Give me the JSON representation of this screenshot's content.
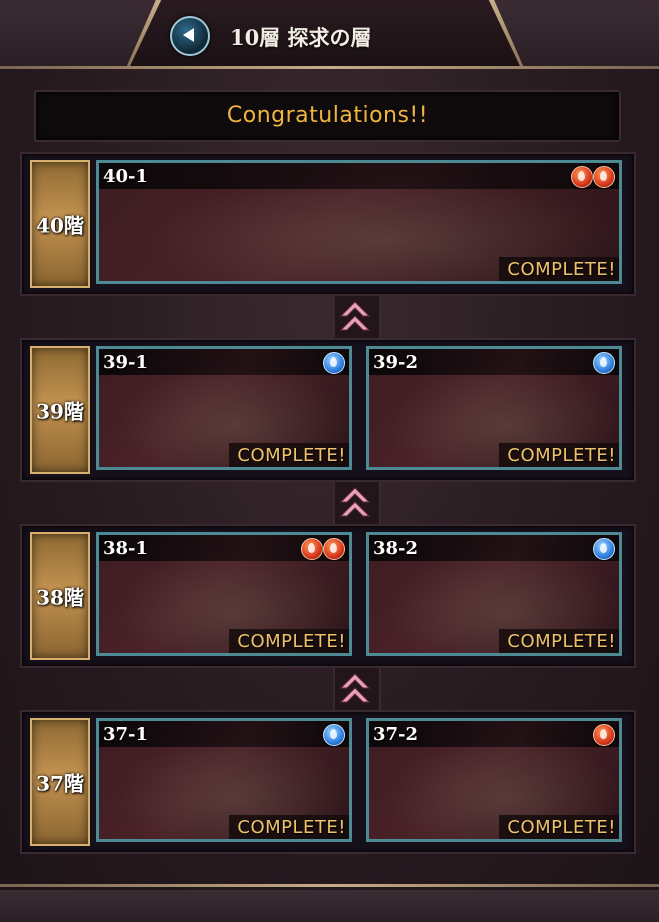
{
  "header": {
    "title": "10層 探求の層"
  },
  "congrats_text": "Congratulations!!",
  "floors": [
    {
      "label": "40階",
      "stages": [
        {
          "name": "40-1",
          "elements": [
            "fire",
            "fire"
          ],
          "status": "COMPLETE!"
        }
      ]
    },
    {
      "label": "39階",
      "stages": [
        {
          "name": "39-1",
          "elements": [
            "water"
          ],
          "status": "COMPLETE!"
        },
        {
          "name": "39-2",
          "elements": [
            "water"
          ],
          "status": "COMPLETE!"
        }
      ]
    },
    {
      "label": "38階",
      "stages": [
        {
          "name": "38-1",
          "elements": [
            "fire",
            "fire"
          ],
          "status": "COMPLETE!"
        },
        {
          "name": "38-2",
          "elements": [
            "water"
          ],
          "status": "COMPLETE!"
        }
      ]
    },
    {
      "label": "37階",
      "stages": [
        {
          "name": "37-1",
          "elements": [
            "water"
          ],
          "status": "COMPLETE!"
        },
        {
          "name": "37-2",
          "elements": [
            "fire"
          ],
          "status": "COMPLETE!"
        }
      ]
    }
  ],
  "colors": {
    "accent_gold": "#f0b441",
    "complete_text": "#eec26a",
    "stage_border": "#4e8a93"
  }
}
